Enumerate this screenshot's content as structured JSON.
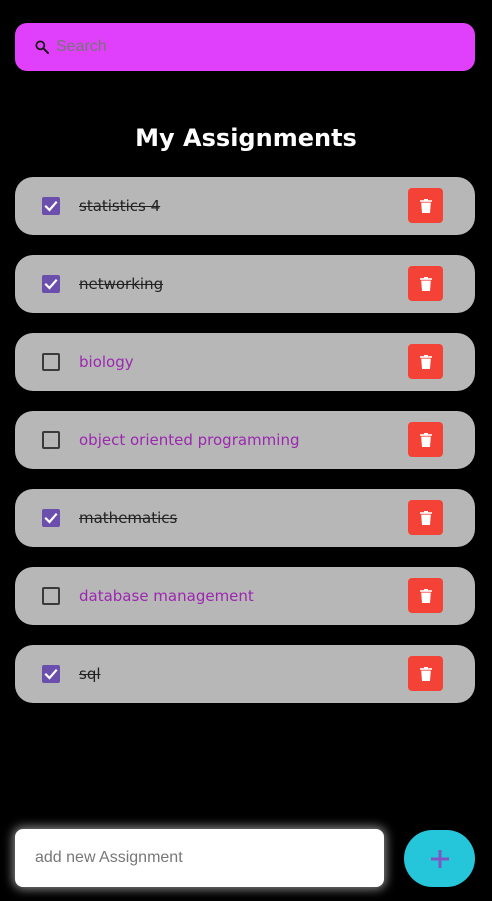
{
  "colors": {
    "search_bg": "#e040fb",
    "card_bg": "#b7b7b7",
    "checkbox_checked": "#6b4fad",
    "pending_text": "#9c27b0",
    "done_text": "#222222",
    "delete_bg": "#f44336",
    "fab_bg": "#26c6da",
    "fab_icon": "#7e57c2"
  },
  "search": {
    "icon": "search-icon",
    "placeholder": "Search"
  },
  "page_title": "My Assignments",
  "assignments": [
    {
      "label": "statistics 4",
      "done": true
    },
    {
      "label": "networking",
      "done": true
    },
    {
      "label": "biology",
      "done": false
    },
    {
      "label": "object oriented programming",
      "done": false
    },
    {
      "label": "mathematics",
      "done": true
    },
    {
      "label": "database management",
      "done": false
    },
    {
      "label": "sql",
      "done": true
    }
  ],
  "new_assignment": {
    "placeholder": "add new Assignment"
  },
  "add_button": {
    "icon": "plus-icon"
  },
  "delete_button": {
    "icon": "trash-icon"
  }
}
